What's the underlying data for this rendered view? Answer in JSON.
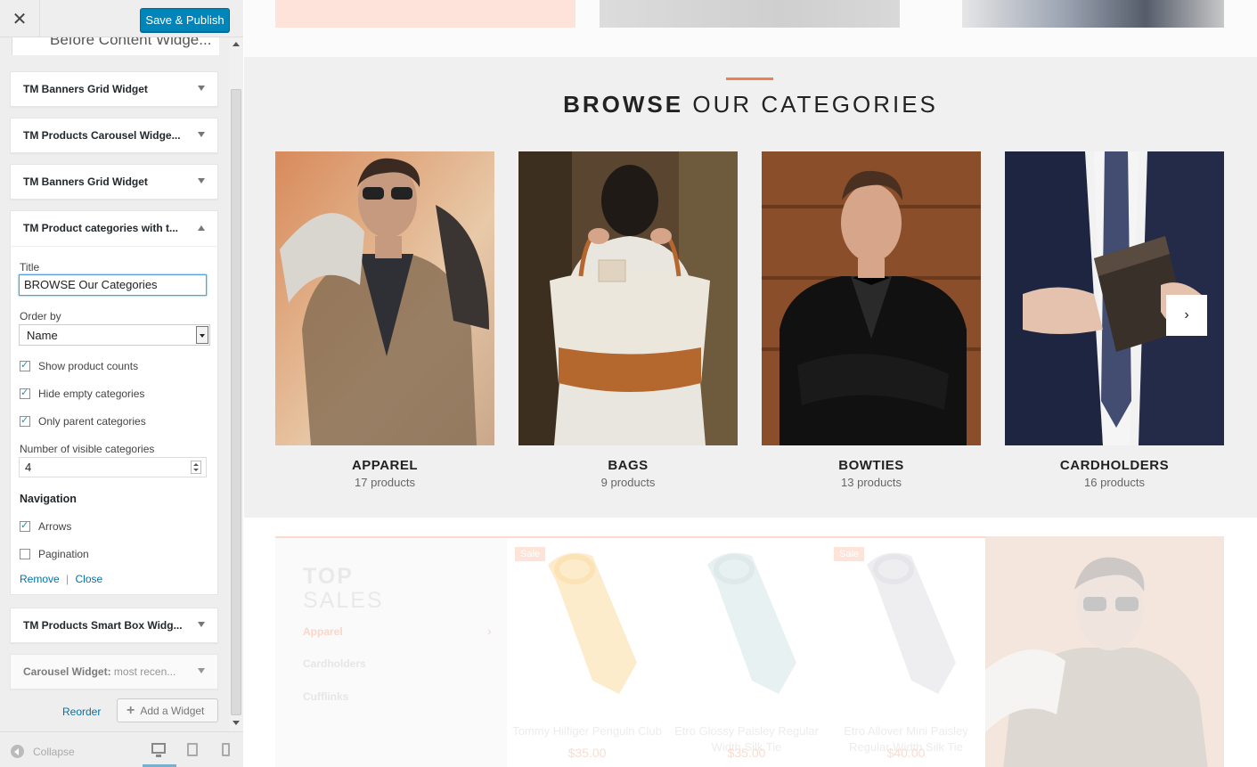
{
  "sidebar": {
    "close_icon": "close-icon",
    "save_label": "Save & Publish",
    "section_title": "Before Content Widge...",
    "widgets_top": [
      {
        "title": "TM Banners Grid Widget"
      },
      {
        "title": "TM Products Carousel Widge..."
      },
      {
        "title": "TM Banners Grid Widget"
      }
    ],
    "open_widget": {
      "title": "TM Product categories with t...",
      "fields": {
        "title_label": "Title",
        "title_value": "BROWSE Our Categories",
        "order_label": "Order by",
        "order_value": "Name",
        "show_counts": "Show product counts",
        "hide_empty": "Hide empty categories",
        "only_parent": "Only parent categories",
        "visible_label": "Number of visible categories",
        "visible_value": "4",
        "navigation_label": "Navigation",
        "arrows": "Arrows",
        "pagination": "Pagination"
      },
      "checkboxes": {
        "show_counts": true,
        "hide_empty": true,
        "only_parent": true,
        "arrows": true,
        "pagination": false
      },
      "remove": "Remove",
      "separator": "|",
      "close": "Close"
    },
    "widgets_bottom": [
      {
        "title": "TM Products Smart Box Widg..."
      },
      {
        "title": "Carousel Widget:",
        "subtitle": "most recen..."
      }
    ],
    "reorder": "Reorder",
    "add_widget": "Add a Widget",
    "collapse": "Collapse"
  },
  "preview": {
    "heading_bold": "BROWSE",
    "heading_rest": "OUR CATEGORIES",
    "accent_color": "#f08054",
    "categories": [
      {
        "name": "APPAREL",
        "count": "17 products"
      },
      {
        "name": "BAGS",
        "count": "9 products"
      },
      {
        "name": "BOWTIES",
        "count": "13 products"
      },
      {
        "name": "CARDHOLDERS",
        "count": "16 products"
      }
    ],
    "next_icon": "chevron-right-icon",
    "sales": {
      "title_1": "TOP",
      "title_2": "SALES",
      "categories": [
        "Apparel",
        "Cardholders",
        "Cufflinks"
      ],
      "products": [
        {
          "sale": "Sale",
          "name": "Tommy Hilfiger Penguin Club",
          "price": "$35.00"
        },
        {
          "sale": "",
          "name": "Etro Glossy Paisley Regular Width Silk Tie",
          "price": "$35.00"
        },
        {
          "sale": "Sale",
          "name": "Etro Allover Mini Paisley Regular Width Silk Tie",
          "price": "$40.00"
        }
      ]
    }
  }
}
